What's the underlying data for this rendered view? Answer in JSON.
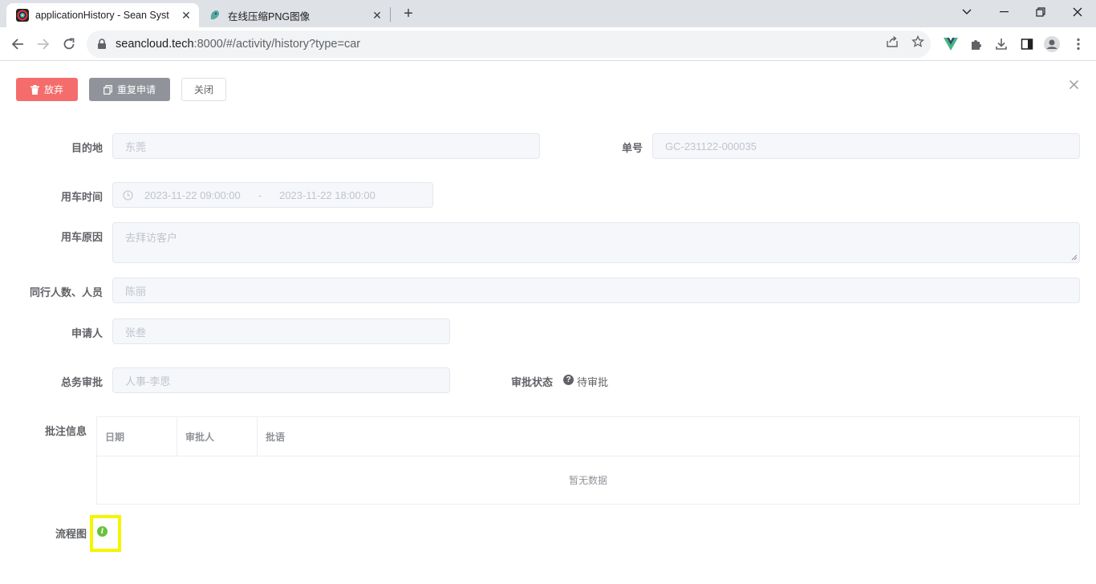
{
  "browser": {
    "tabs": [
      {
        "title": "applicationHistory - Sean Syst",
        "active": true
      },
      {
        "title": "在线压缩PNG图像",
        "active": false
      }
    ],
    "url_host": "seancloud.tech",
    "url_rest": ":8000/#/activity/history?type=car"
  },
  "actions": {
    "abandon": "放弃",
    "reapply": "重复申请",
    "close": "关闭"
  },
  "form": {
    "destination": {
      "label": "目的地",
      "value": "东莞"
    },
    "order_no": {
      "label": "单号",
      "value": "GC-231122-000035"
    },
    "use_time": {
      "label": "用车时间",
      "start": "2023-11-22 09:00:00",
      "separator": "-",
      "end": "2023-11-22 18:00:00"
    },
    "reason": {
      "label": "用车原因",
      "value": "去拜访客户"
    },
    "companions": {
      "label": "同行人数、人员",
      "value": "陈丽"
    },
    "applicant": {
      "label": "申请人",
      "value": "张叁"
    },
    "general_approval": {
      "label": "总务审批",
      "value": "人事-李思"
    },
    "approval_status": {
      "label": "审批状态",
      "value": "待审批"
    }
  },
  "comments": {
    "label": "批注信息",
    "columns": [
      "日期",
      "审批人",
      "批语"
    ],
    "empty_text": "暂无数据"
  },
  "flowchart": {
    "label": "流程图"
  },
  "colors": {
    "danger": "#f56c6c",
    "info": "#909399",
    "success": "#67c23a",
    "highlight": "#f5f500"
  }
}
